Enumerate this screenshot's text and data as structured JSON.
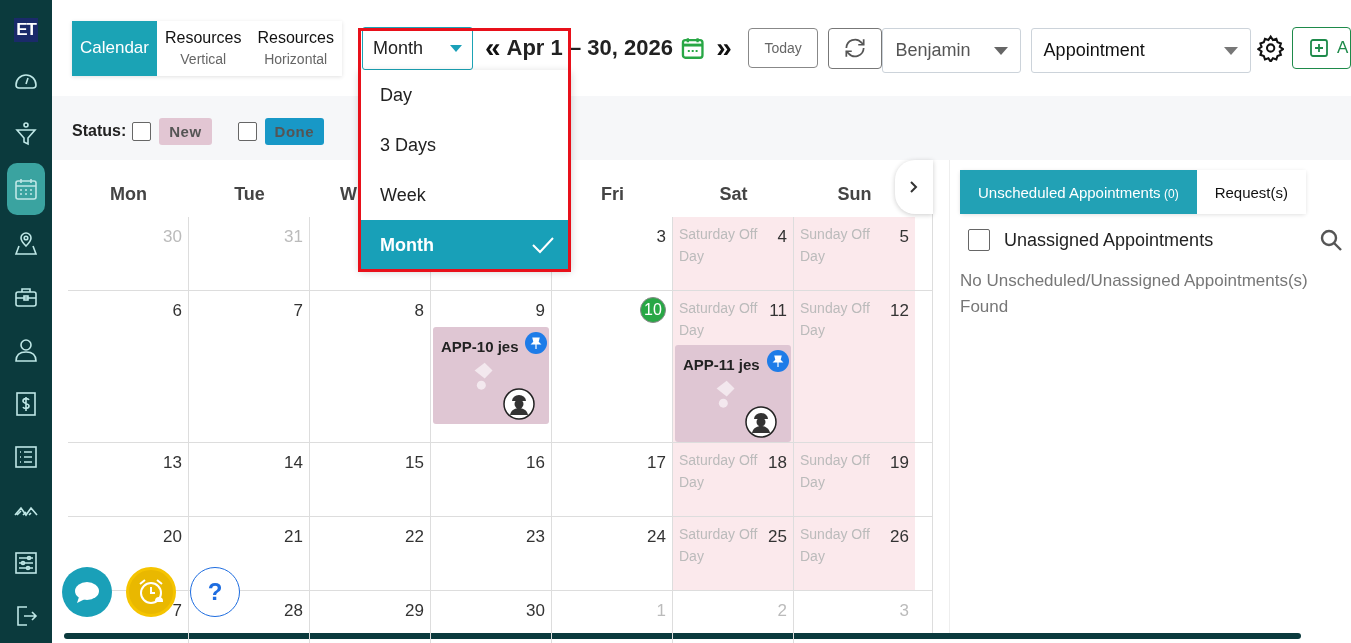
{
  "sidebar": {
    "logo": "ET",
    "items": [
      {
        "kind": "gauge",
        "selected": false
      },
      {
        "kind": "funnel",
        "selected": false
      },
      {
        "kind": "calendar",
        "selected": true
      },
      {
        "kind": "map",
        "selected": false
      },
      {
        "kind": "briefcase",
        "selected": false
      },
      {
        "kind": "person",
        "selected": false
      },
      {
        "kind": "dollar",
        "selected": false
      },
      {
        "kind": "list",
        "selected": false
      },
      {
        "kind": "bridge",
        "selected": false
      },
      {
        "kind": "sliders",
        "selected": false
      },
      {
        "kind": "logout",
        "selected": false
      }
    ]
  },
  "view_tabs": [
    {
      "label": "Calendar",
      "selected": true
    },
    {
      "label": "Resources",
      "sub": "Vertical",
      "selected": false
    },
    {
      "label": "Resources",
      "sub": "Horizontal",
      "selected": false
    }
  ],
  "range_select": {
    "value": "Month",
    "options": [
      {
        "label": "Day",
        "selected": false
      },
      {
        "label": "3 Days",
        "selected": false
      },
      {
        "label": "Week",
        "selected": false
      },
      {
        "label": "Month",
        "selected": true
      }
    ]
  },
  "prev": "«",
  "date_range": "Apr 1 – 30, 2026",
  "next": "»",
  "today_button": "Today",
  "resource_select": "Benjamin",
  "type_select": "Appointment",
  "add_button": "A",
  "status": {
    "label": "Status:",
    "filters": [
      {
        "label": "New",
        "checked": false,
        "color": "#e2c6d3"
      },
      {
        "label": "Done",
        "checked": false,
        "color": "#1898c7"
      }
    ]
  },
  "weekdays": [
    {
      "kind": "label",
      "label": "Mon"
    },
    {
      "kind": "label",
      "label": "Tue"
    },
    {
      "kind": "cut",
      "label": "W"
    },
    {
      "kind": "label",
      "label": "Fri"
    },
    {
      "kind": "label",
      "label": "Sat"
    },
    {
      "kind": "label",
      "label": "Sun"
    }
  ],
  "weeks": [
    {
      "days": [
        {
          "day": "30",
          "outside": true
        },
        {
          "day": "31",
          "outside": true
        }
      ],
      "days_after_gap": [
        {
          "day": "3"
        },
        {
          "day": "4",
          "off": true,
          "note": "Saturday Off Day"
        },
        {
          "day": "5",
          "off": true,
          "note": "Sunday Off Day"
        }
      ]
    },
    {
      "days": [
        {
          "day": "6"
        },
        {
          "day": "7"
        },
        {
          "day": "8"
        },
        {
          "day": "9",
          "events": [
            {
              "title": "APP-10 jes",
              "pinned": true
            }
          ]
        },
        {
          "day": "10",
          "today": true
        },
        {
          "day": "11",
          "off": true,
          "note": "Saturday Off Day",
          "events": [
            {
              "title": "APP-11 jes",
              "pinned": true
            }
          ]
        },
        {
          "day": "12",
          "off": true,
          "note": "Sunday Off Day"
        }
      ]
    },
    {
      "days": [
        {
          "day": "13"
        },
        {
          "day": "14"
        },
        {
          "day": "15"
        },
        {
          "day": "16"
        },
        {
          "day": "17"
        },
        {
          "day": "18",
          "off": true,
          "note": "Saturday Off Day"
        },
        {
          "day": "19",
          "off": true,
          "note": "Sunday Off Day"
        }
      ]
    },
    {
      "days": [
        {
          "day": "20"
        },
        {
          "day": "21"
        },
        {
          "day": "22"
        },
        {
          "day": "23"
        },
        {
          "day": "24"
        },
        {
          "day": "25",
          "off": true,
          "note": "Saturday Off Day"
        },
        {
          "day": "26",
          "off": true,
          "note": "Sunday Off Day"
        }
      ]
    },
    {
      "days": [
        {
          "day": "7"
        },
        {
          "day": "28"
        },
        {
          "day": "29"
        },
        {
          "day": "30"
        },
        {
          "day": "1",
          "outside": true
        },
        {
          "day": "2",
          "outside": true
        },
        {
          "day": "3",
          "outside": true
        }
      ]
    }
  ],
  "panel": {
    "tabs": [
      {
        "label": "Unscheduled Appointments",
        "count": "(0)",
        "selected": true
      },
      {
        "label": "Request(s)",
        "selected": false
      }
    ],
    "unassigned": {
      "label": "Unassigned Appointments",
      "checked": false
    },
    "empty_message": "No Unscheduled/Unassigned Appointments(s) Found"
  },
  "help_button": "?"
}
